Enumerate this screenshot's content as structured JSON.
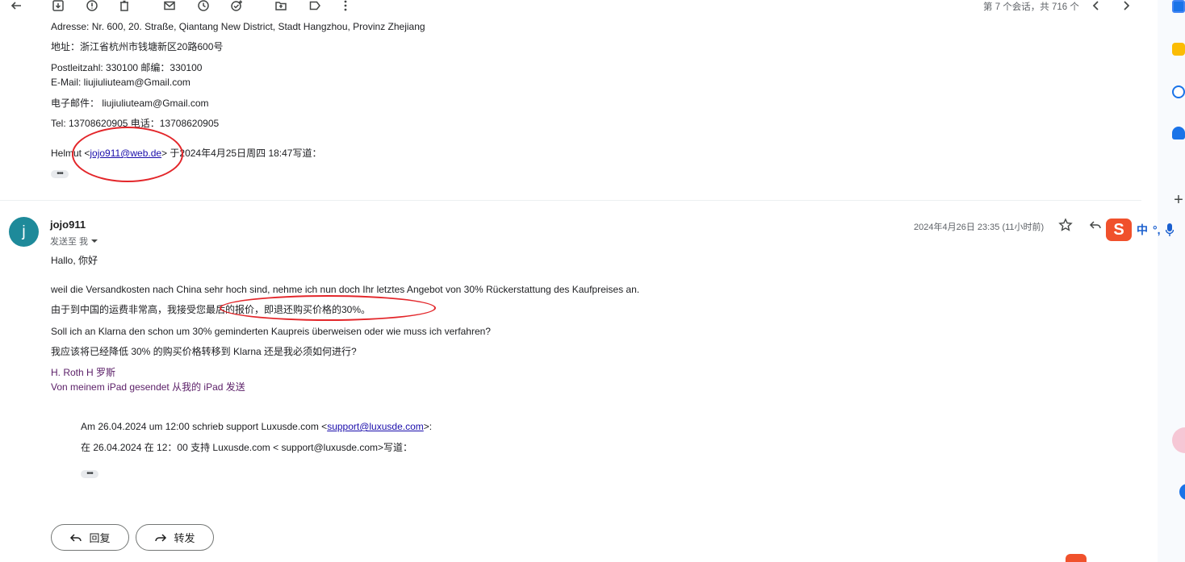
{
  "toolbar": {
    "icons": [
      "back-arrow-icon",
      "archive-icon",
      "report-spam-icon",
      "delete-icon",
      "mark-unread-icon",
      "snooze-icon",
      "add-task-icon",
      "move-to-icon",
      "label-icon",
      "more-icon"
    ],
    "pager_text": "第 7 个会话，共 716 个"
  },
  "prev_message": {
    "address_de": "Adresse: Nr. 600, 20. Straße, Qiantang New District, Stadt Hangzhou, Provinz Zhejiang",
    "address_zh": "地址：浙江省杭州市钱塘新区20路600号",
    "postcode": "Postleitzahl: 330100 邮编：330100",
    "email_de": "E-Mail: liujiuliuteam@Gmail.com",
    "email_zh": "电子邮件： liujiuliuteam@Gmail.com",
    "tel": "Tel: 13708620905 电话：13708620905",
    "quote_prefix": "Helmut <",
    "quote_link": "jojo911@web.de",
    "quote_suffix": "> 于2024年4月25日周四 18:47写道：",
    "ellipsis": "•••"
  },
  "message": {
    "avatar_letter": "j",
    "sender": "jojo911",
    "to": "发送至 我",
    "date": "2024年4月26日 23:35 (11小时前)",
    "greeting": "Hallo, 你好",
    "line1": "weil die Versandkosten nach China sehr hoch sind, nehme ich nun doch Ihr letztes Angebot von 30% Rückerstattung des Kaufpreises an.",
    "line2": "由于到中国的运费非常高，我接受您最后的报价，即退还购买价格的30%。",
    "line3": "Soll ich an Klarna den schon um 30% geminderten Kaupreis überweisen oder wie muss ich verfahren?",
    "line4": "我应该将已经降低 30% 的购买价格转移到 Klarna 还是我必须如何进行?",
    "signature1": "H. Roth H 罗斯",
    "signature2": "Von meinem iPad gesendet 从我的 iPad 发送",
    "quote_de_prefix": "Am 26.04.2024 um 12:00 schrieb support Luxusde.com <",
    "quote_de_link": "support@luxusde.com",
    "quote_de_suffix": ">:",
    "quote_zh": "在 26.04.2024 在 12：00 支持 Luxusde.com < support@luxusde.com>写道：",
    "ellipsis": "•••"
  },
  "actions": {
    "reply_label": "回复",
    "forward_label": "转发"
  },
  "ime": {
    "logo": "S",
    "mode": "中",
    "punct": "°,"
  },
  "side_panel": {
    "icons": [
      "calendar-icon",
      "keep-icon",
      "tasks-icon",
      "contacts-icon",
      "add-icon"
    ],
    "add_label": "+"
  },
  "colors": {
    "annotation_red": "#e3262a",
    "link_blue": "#1a0dab",
    "avatar_teal": "#1e8a9a",
    "ime_orange": "#f0512c"
  }
}
